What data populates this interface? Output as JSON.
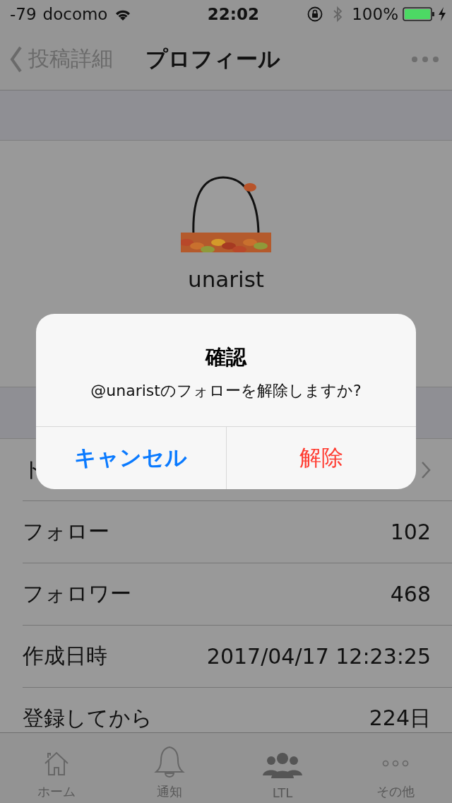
{
  "status_bar": {
    "signal": "-79",
    "carrier": "docomo",
    "time": "22:02",
    "battery": "100%"
  },
  "nav": {
    "back": "投稿詳細",
    "title": "プロフィール"
  },
  "profile": {
    "name": "unarist"
  },
  "rows": [
    {
      "kind": "link",
      "label": "ト"
    },
    {
      "kind": "value",
      "label": "フォロー",
      "value": "102"
    },
    {
      "kind": "value",
      "label": "フォロワー",
      "value": "468"
    },
    {
      "kind": "value",
      "label": "作成日時",
      "value": "2017/04/17 12:23:25"
    },
    {
      "kind": "value",
      "label": "登録してから",
      "value": "224日"
    }
  ],
  "dialog": {
    "title": "確認",
    "message": "@unaristのフォローを解除しますか?",
    "buttons": [
      {
        "kind": "cancel",
        "label": "キャンセル"
      },
      {
        "kind": "destructive",
        "label": "解除"
      }
    ]
  },
  "tab_bar": [
    {
      "label": "ホーム",
      "selected": false
    },
    {
      "label": "通知",
      "selected": false
    },
    {
      "label": "LTL",
      "selected": true
    },
    {
      "label": "その他",
      "selected": false
    }
  ]
}
